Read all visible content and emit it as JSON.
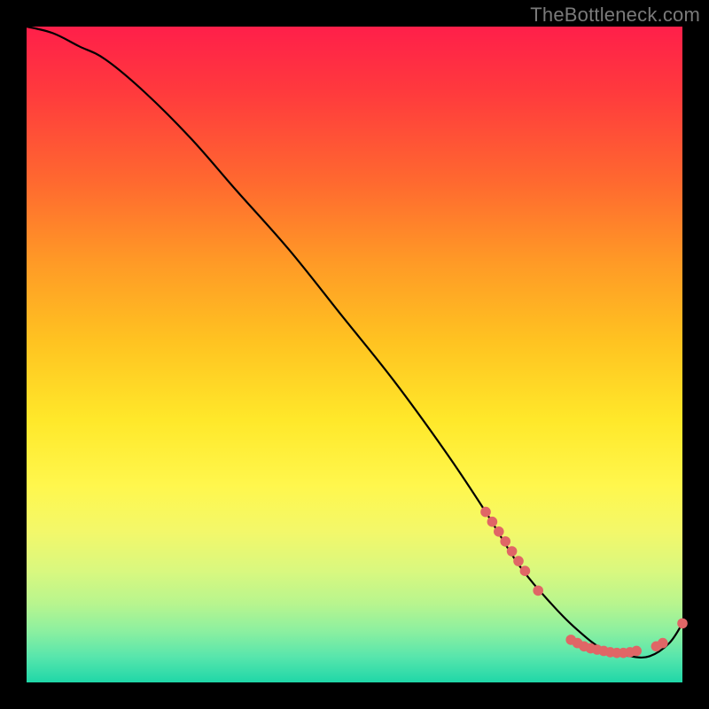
{
  "watermark": "TheBottleneck.com",
  "chart_data": {
    "type": "line",
    "title": "",
    "xlabel": "",
    "ylabel": "",
    "xrange": [
      0,
      100
    ],
    "yrange": [
      0,
      100
    ],
    "legend": false,
    "grid": false,
    "series": [
      {
        "name": "curve",
        "color": "#000000",
        "x": [
          0,
          4,
          8,
          12,
          18,
          25,
          32,
          40,
          48,
          56,
          64,
          70,
          75,
          80,
          84,
          88,
          92,
          95,
          98,
          100
        ],
        "y": [
          100,
          99,
          97,
          95,
          90,
          83,
          75,
          66,
          56,
          46,
          35,
          26,
          18,
          12,
          8,
          5,
          4,
          4,
          6,
          9
        ]
      }
    ],
    "marker_clusters": [
      {
        "name": "cluster-a",
        "color": "#e06666",
        "points": [
          {
            "x": 70,
            "y": 26
          },
          {
            "x": 71,
            "y": 24.5
          },
          {
            "x": 72,
            "y": 23
          },
          {
            "x": 73,
            "y": 21.5
          },
          {
            "x": 74,
            "y": 20
          },
          {
            "x": 75,
            "y": 18.5
          },
          {
            "x": 76,
            "y": 17
          }
        ]
      },
      {
        "name": "cluster-b",
        "color": "#e06666",
        "points": [
          {
            "x": 78,
            "y": 14
          }
        ]
      },
      {
        "name": "cluster-c-bottom",
        "color": "#e06666",
        "points": [
          {
            "x": 83,
            "y": 6.5
          },
          {
            "x": 84,
            "y": 6
          },
          {
            "x": 85,
            "y": 5.5
          },
          {
            "x": 86,
            "y": 5.2
          },
          {
            "x": 87,
            "y": 5
          },
          {
            "x": 88,
            "y": 4.8
          },
          {
            "x": 89,
            "y": 4.6
          },
          {
            "x": 90,
            "y": 4.5
          },
          {
            "x": 91,
            "y": 4.5
          },
          {
            "x": 92,
            "y": 4.6
          },
          {
            "x": 93,
            "y": 4.8
          }
        ]
      },
      {
        "name": "cluster-d",
        "color": "#e06666",
        "points": [
          {
            "x": 96,
            "y": 5.5
          },
          {
            "x": 97,
            "y": 6
          }
        ]
      },
      {
        "name": "cluster-e",
        "color": "#e06666",
        "points": [
          {
            "x": 100,
            "y": 9
          }
        ]
      }
    ]
  }
}
